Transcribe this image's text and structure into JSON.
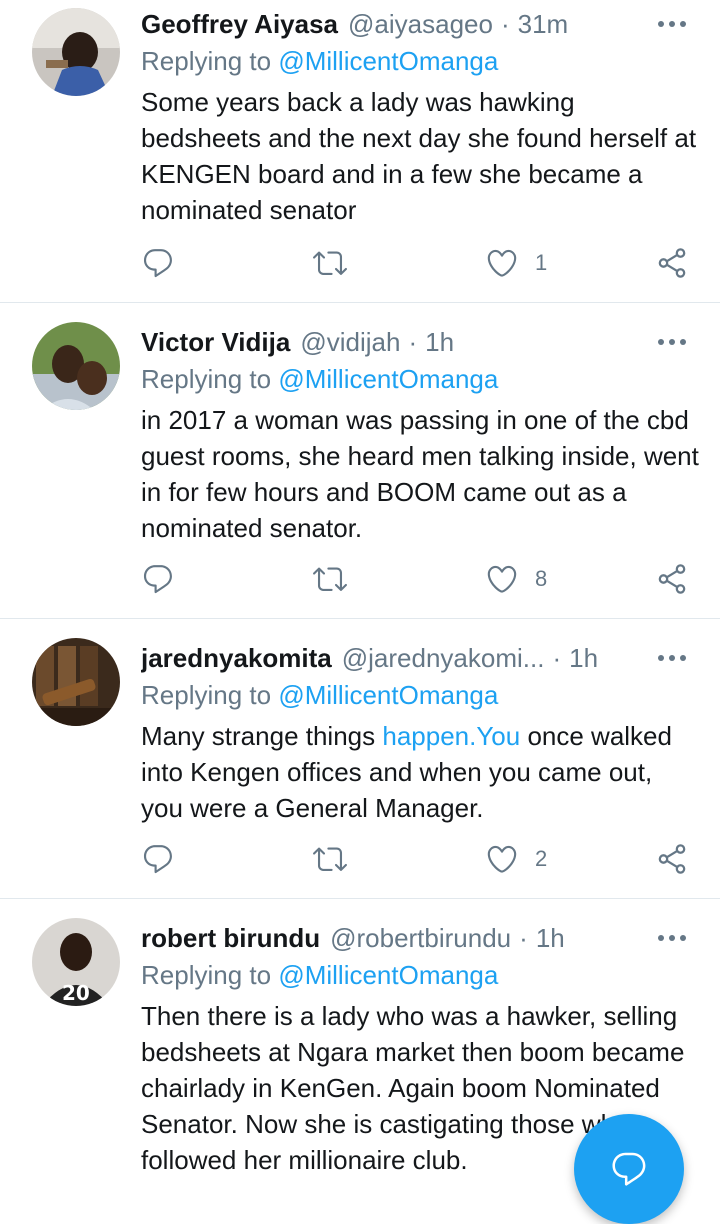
{
  "tweets": [
    {
      "name": "Geoffrey Aiyasa",
      "handle": "@aiyasageo",
      "time": "31m",
      "replying_prefix": "Replying to",
      "replying_to": "@MillicentOmanga",
      "text": "Some years back a lady was hawking bedsheets and the next day she found herself at KENGEN board and in a few she became a nominated senator",
      "likes": "1"
    },
    {
      "name": "Victor Vidija",
      "handle": "@vidijah",
      "time": "1h",
      "replying_prefix": "Replying to",
      "replying_to": "@MillicentOmanga",
      "text": "in 2017  a woman was passing in one of the cbd guest rooms, she heard  men talking inside, went in for few hours and BOOM came out as a nominated senator.",
      "likes": "8"
    },
    {
      "name": "jarednyakomita",
      "handle": "@jarednyakomi...",
      "time": "1h",
      "replying_prefix": "Replying to",
      "replying_to": "@MillicentOmanga",
      "text_before": "Many strange things ",
      "text_link": "happen.You",
      "text_after": " once walked into Kengen offices and when you came out, you were a General Manager.",
      "likes": "2"
    },
    {
      "name": "robert birundu",
      "handle": "@robertbirundu",
      "time": "1h",
      "replying_prefix": "Replying to",
      "replying_to": "@MillicentOmanga",
      "text": "Then there is a lady who was a hawker, selling bedsheets at Ngara market then boom  became chairlady in KenGen. Again boom Nominated Senator. Now she is castigating those who followed her millionaire club."
    }
  ],
  "icons": {
    "reply": "reply-icon",
    "retweet": "retweet-icon",
    "like": "heart-icon",
    "share": "share-icon",
    "more": "more-icon",
    "compose": "compose-reply-icon"
  },
  "colors": {
    "accent": "#1da1f2",
    "secondary_text": "#657786",
    "divider": "#e1e8ed"
  }
}
